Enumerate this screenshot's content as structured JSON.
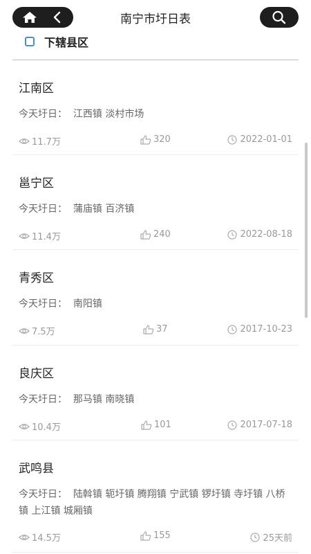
{
  "header": {
    "title": "南宁市圩日表"
  },
  "section": {
    "label": "下辖县区"
  },
  "market_prefix": "今天圩日：",
  "districts": [
    {
      "name": "江南区",
      "markets": "江西镇 淡村市场",
      "views": "11.7万",
      "likes": "320",
      "date": "2022-01-01"
    },
    {
      "name": "邕宁区",
      "markets": "蒲庙镇 百济镇",
      "views": "11.4万",
      "likes": "240",
      "date": "2022-08-18"
    },
    {
      "name": "青秀区",
      "markets": "南阳镇",
      "views": "7.5万",
      "likes": "37",
      "date": "2017-10-23"
    },
    {
      "name": "良庆区",
      "markets": "那马镇 南晓镇",
      "views": "10.4万",
      "likes": "101",
      "date": "2017-07-18"
    },
    {
      "name": "武鸣县",
      "markets": "陆斡镇 轭圩镇 腾翔镇 宁武镇 锣圩镇 寺圩镇 八桥镇 上江镇 城厢镇",
      "views": "14.5万",
      "likes": "155",
      "date": "25天前"
    }
  ],
  "colors": {
    "pill_bg": "#1e1e1e",
    "accent": "#3a8fe6",
    "meta_text": "#999999"
  }
}
